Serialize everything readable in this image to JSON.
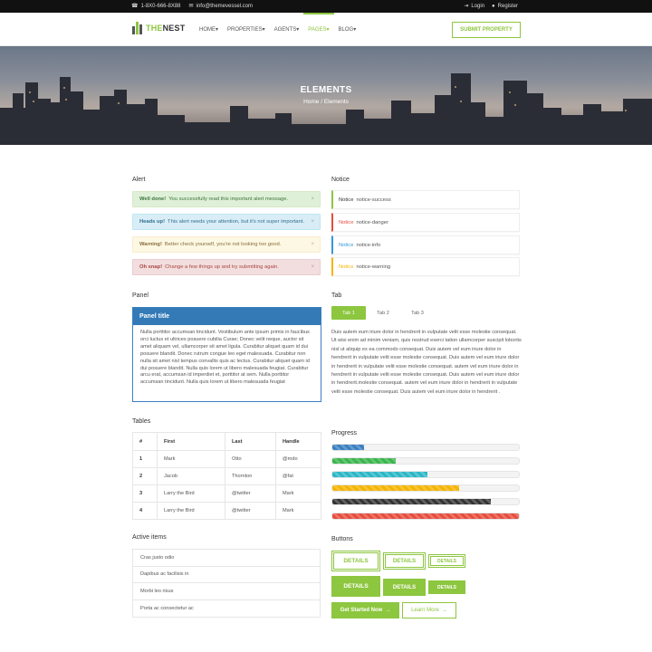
{
  "topbar": {
    "phone": "1-8X0-666-8X88",
    "email": "info@themevessel.com",
    "login": "Login",
    "register": "Register",
    "icons": [
      "phone-icon",
      "envelope-icon",
      "sign-in-icon",
      "user-icon"
    ]
  },
  "header": {
    "logo_accent": "THE",
    "logo_main": "NEST",
    "nav": [
      "HOME",
      "PROPERTIES",
      "AGENTS",
      "PAGES",
      "BLOG"
    ],
    "active_nav": "PAGES",
    "submit": "SUBMIT PROPERTY"
  },
  "hero": {
    "title": "ELEMENTS",
    "breadcrumb": "Home  /  Elements"
  },
  "alerts": {
    "title": "Alert",
    "items": [
      {
        "strong": "Well done!",
        "text": "You successfully read this important alert message.",
        "type": "success"
      },
      {
        "strong": "Heads up!",
        "text": "This alert needs your attention, but it's not super important.",
        "type": "info"
      },
      {
        "strong": "Warning!",
        "text": "Better check yourself, you're not looking too good.",
        "type": "warning"
      },
      {
        "strong": "Oh snap!",
        "text": "Change a few things up and try submitting again.",
        "type": "danger"
      }
    ],
    "close": "×"
  },
  "notices": {
    "title": "Notice",
    "items": [
      {
        "label": "Notice",
        "text": "notice-success",
        "color": "#8dc63f"
      },
      {
        "label": "Notice",
        "text": "notice-danger",
        "color": "#e74c3c"
      },
      {
        "label": "Notice",
        "text": "notice-info",
        "color": "#3498db"
      },
      {
        "label": "Notice",
        "text": "notice-warning",
        "color": "#f5b400"
      }
    ]
  },
  "panel": {
    "title": "Panel",
    "heading": "Panel title",
    "body": "Nulla porttitor accumsan tincidunt. Vestibulum ante ipsum primis in faucibus orci luctus et ultrices posuere cubilia Curae; Donec velit neque, auctor sit amet aliquam vel, ullamcorper sit amet ligula. Curabitur aliquet quam id dui posuere blandit. Donec rutrum congue leo eget malesuada. Curabitur non nulla sit amet nisl tempus convallis quis ac lectus. Curabitur aliquet quam id dui posuere blandit. Nulla quis lorem ut libero malesuada feugiat. Curabitur arcu erat, accumsan id imperdiet et, porttitor at sem. Nulla porttitor accumsan tincidunt. Nulla quis lorem ut libero malesuada feugiat"
  },
  "tabs": {
    "title": "Tab",
    "labels": [
      "Tab 1",
      "Tab 2",
      "Tab 3"
    ],
    "active": 0,
    "body": "Duis autem eum iriure dolor in hendrerit in vulputate velit esse molestie consequat. Ut wisi enim ad minim veniam, quis nostrud exerci tation ullamcorper suscipit lobortis nisl ut aliquip ex ea commodo consequat. Duis autem vel eum iriure dolor in hendrerit in vulputate velit esse molestie consequat. Duis autem vel eum iriure dolor in hendrerit in vulputate velit esse molestie consequat. autem vel eum iriure dolor in hendrerit in vulputate velit esse molestie consequat. Duis autem vel eum iriure dolor in hendrerit.molestie consequat. autem vel eum iriure dolor in hendrerit in vulputate velit esse molestie consequat. Duis autem vel eum iriure dolor in hendrerit ."
  },
  "table": {
    "title": "Tables",
    "headers": [
      "#",
      "First",
      "Last",
      "Handle"
    ],
    "rows": [
      [
        "1",
        "Mark",
        "Otto",
        "@mdo"
      ],
      [
        "2",
        "Jacob",
        "Thornton",
        "@fat"
      ],
      [
        "3",
        "Larry the Bird",
        "@twitter",
        "Mark"
      ],
      [
        "4",
        "Larry the Bird",
        "@twitter",
        "Mark"
      ]
    ]
  },
  "progress": {
    "title": "Progress",
    "bars": [
      {
        "value": 0.17,
        "color": "#3a7fc1"
      },
      {
        "value": 0.34,
        "color": "#39b54a"
      },
      {
        "value": 0.51,
        "color": "#29b6c6"
      },
      {
        "value": 0.68,
        "color": "#f5b400"
      },
      {
        "value": 0.85,
        "color": "#333333"
      },
      {
        "value": 1.0,
        "color": "#e74c3c"
      }
    ]
  },
  "active_items": {
    "title": "Active items",
    "items": [
      "Cras justo odio",
      "Dapibus ac facilisis in",
      "Morbi leo risus",
      "Porta ac consectetur ac"
    ]
  },
  "buttons": {
    "title": "Buttons",
    "details": "DETAILS",
    "get_started": "Get Started Now",
    "learn_more": "Learn More",
    "arrow": "→"
  },
  "colors": {
    "accent": "#8dc63f",
    "panel_blue": "#337ab7"
  }
}
